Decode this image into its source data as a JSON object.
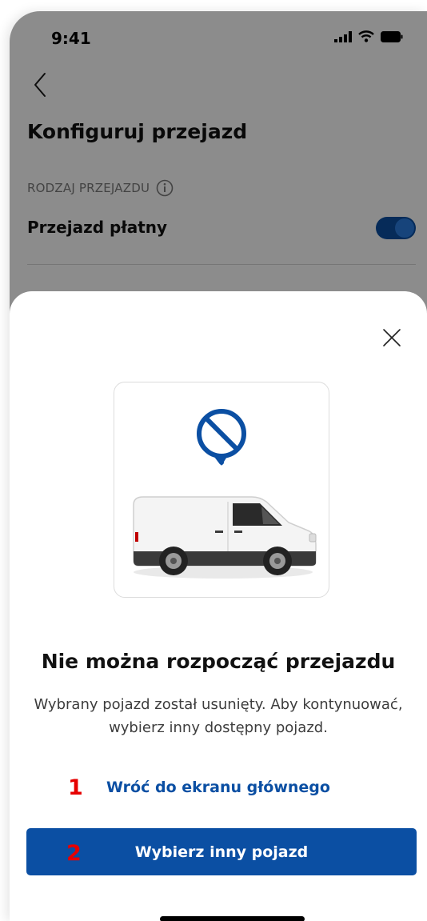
{
  "status_bar": {
    "time": "9:41",
    "icons": [
      "signal-icon",
      "wifi-icon",
      "battery-icon"
    ]
  },
  "background_screen": {
    "back_icon": "chevron-left-icon",
    "title": "Konfiguruj przejazd",
    "section_label": "RODZAJ PRZEJAZDU",
    "section_info_icon": "info-icon",
    "toggle_label": "Przejazd płatny",
    "toggle_on": true
  },
  "sheet": {
    "close_icon": "close-icon",
    "illustration": {
      "ban_icon": "ban-icon",
      "vehicle": "van-image"
    },
    "title": "Nie można rozpocząć przejazdu",
    "message": "Wybrany pojazd został usunięty. Aby kontynuować, wybierz inny dostępny pojazd.",
    "secondary_action": "Wróć do ekranu głównego",
    "primary_action": "Wybierz inny pojazd"
  },
  "annotations": [
    "1",
    "2"
  ],
  "colors": {
    "brand_blue": "#0b4fa3",
    "annotation_red": "#e60000",
    "overlay": "rgba(0,0,0,0.45)"
  }
}
